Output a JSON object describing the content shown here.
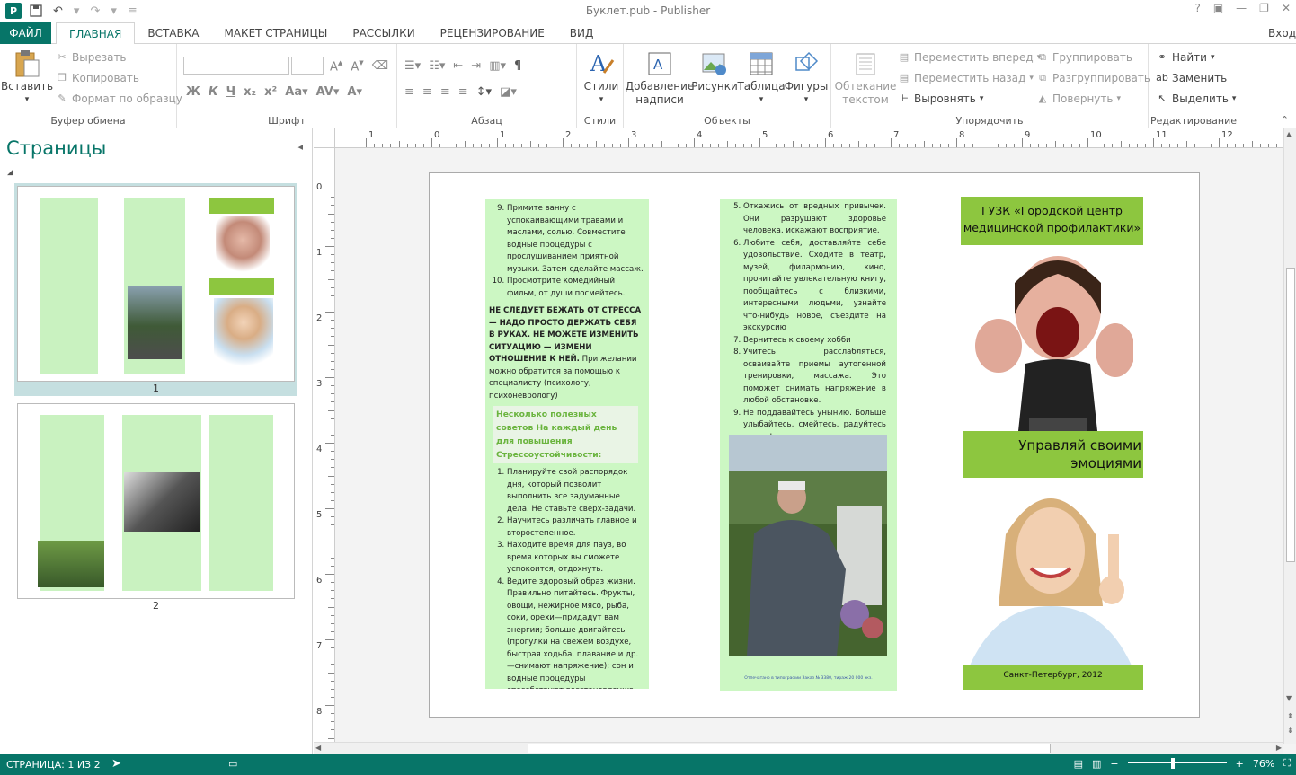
{
  "window": {
    "title": "Буклет.pub - Publisher",
    "signin": "Вход"
  },
  "qat": {
    "undo": "↶",
    "redo": "↷"
  },
  "tabs": {
    "file": "ФАЙЛ",
    "items": [
      "ГЛАВНАЯ",
      "ВСТАВКА",
      "МАКЕТ СТРАНИЦЫ",
      "РАССЫЛКИ",
      "РЕЦЕНЗИРОВАНИЕ",
      "ВИД"
    ]
  },
  "ribbon": {
    "clipboard": {
      "label": "Буфер обмена",
      "paste": "Вставить",
      "cut": "Вырезать",
      "copy": "Копировать",
      "format_painter": "Формат по образцу"
    },
    "font": {
      "label": "Шрифт",
      "bold": "Ж",
      "italic": "К",
      "underline": "Ч"
    },
    "paragraph": {
      "label": "Абзац"
    },
    "styles": {
      "label": "Стили",
      "styles_btn": "Стили"
    },
    "objects": {
      "label": "Объекты",
      "textbox": "Добавление надписи",
      "pictures": "Рисунки",
      "table": "Таблица",
      "shapes": "Фигуры"
    },
    "arrange": {
      "label": "Упорядочить",
      "wrap": "Обтекание текстом",
      "bring_forward": "Переместить вперед",
      "send_backward": "Переместить назад",
      "align": "Выровнять",
      "group": "Группировать",
      "ungroup": "Разгруппировать",
      "rotate": "Повернуть"
    },
    "editing": {
      "label": "Редактирование",
      "find": "Найти",
      "replace": "Заменить",
      "select": "Выделить"
    }
  },
  "pages_pane": {
    "title": "Страницы",
    "pages": [
      "1",
      "2"
    ]
  },
  "ruler": {
    "h": [
      "1",
      "0",
      "1",
      "2",
      "3",
      "4",
      "5",
      "6",
      "7",
      "8",
      "9",
      "10",
      "11",
      "12"
    ],
    "v": [
      "0",
      "1",
      "2",
      "3",
      "4",
      "5",
      "6",
      "7",
      "8"
    ]
  },
  "doc": {
    "col1": {
      "items_top": [
        "Примите ванну с успокаивающими травами и маслами, солью. Совместите водные процедуры с прослушиванием приятной музыки. Затем сделайте массаж.",
        "Просмотрите комедийный фильм, от души посмейтесь."
      ],
      "bold": "НЕ СЛЕДУЕТ БЕЖАТЬ ОТ СТРЕССА — НАДО ПРОСТО ДЕРЖАТЬ СЕБЯ В РУКАХ. НЕ МОЖЕТЕ ИЗМЕНИТЬ СИТУАЦИЮ — ИЗМЕНИ ОТНОШЕНИЕ К НЕЙ.",
      "bold_tail": "При желании можно обратится за помощью к специалисту (психологу, психоневрологу)",
      "heading": "Несколько полезных советов На каждый день для повышения Стрессоустойчивости:",
      "tips": [
        "Планируйте свой распорядок дня, который позволит выполнить все задуманные дела. Не ставьте сверх-задачи.",
        "Научитесь различать главное и второстепенное.",
        "Находите время для пауз, во время которых вы сможете успокоится, отдохнуть.",
        "Ведите здоровый образ жизни. Правильно питайтесь. Фрукты, овощи, нежирное мясо, рыба, соки, орехи—придадут вам энергии; больше двигайтесь (прогулки на свежем воздухе, быстрая ходьба, плавание и др. —снимают напряжение); сон и водные процедуры способствуют восстановлению всех физических систем организма (сердечно-сосудистой, мышечной, нервной, иммунной)."
      ]
    },
    "col2": {
      "items": [
        "Откажись от вредных привычек. Они разрушают здоровье человека, искажают восприятие.",
        "Любите себя, доставляйте себе удовольствие. Сходите в театр, музей, филармонию, кино, прочитайте увлекательную книгу, пообщайтесь с близкими, интересными людьми, узнайте что-нибудь новое, съездите на экскурсию",
        "Вернитесь к своему хобби",
        "Учитесь расслабляться, осваивайте приемы аутогенной тренировки, массажа. Это поможет снимать напряжение в любой обстановке.",
        "Не поддавайтесь унынию. Больше улыбайтесь, смейтесь, радуйтесь жизни!"
      ],
      "footer": "Отпечатано в типографии Заказ № 3380, тираж 20 000 экз."
    },
    "col3": {
      "org": "ГУЗК «Городской центр медицинской профилактики»",
      "slogan": "Управляй своими эмоциями",
      "city": "Санкт-Петербург, 2012"
    }
  },
  "status": {
    "page": "СТРАНИЦА: 1 ИЗ 2",
    "zoom": "76%",
    "minus": "−",
    "plus": "+"
  },
  "colors": {
    "accent": "#077568",
    "green_panel": "#ccf7c3",
    "green_header": "#8dc63f"
  }
}
